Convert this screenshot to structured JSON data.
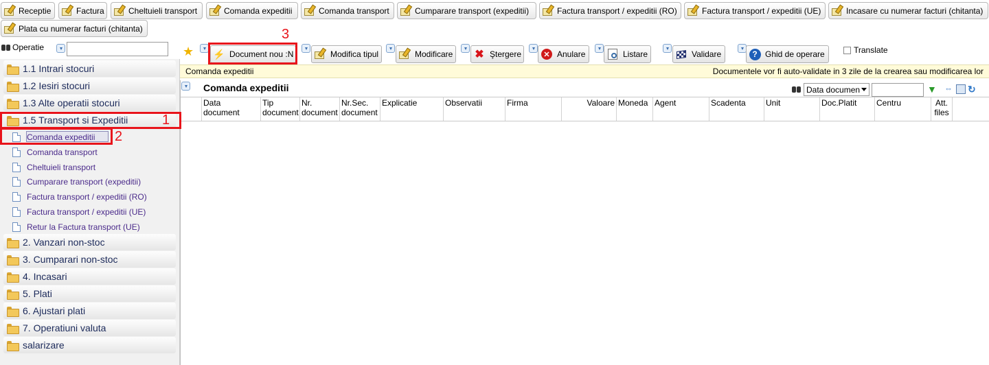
{
  "quick_tabs": [
    "Receptie",
    "Factura",
    "Cheltuieli transport",
    "Comanda expeditii",
    "Comanda transport",
    "Cumparare transport (expeditii)",
    "Factura transport / expeditii (RO)",
    "Factura transport / expeditii (UE)",
    "Incasare cu numerar facturi (chitanta)",
    "Plata cu numerar facturi (chitanta)"
  ],
  "operatie": {
    "label": "Operatie",
    "search_value": ""
  },
  "sidebar": {
    "groups": [
      "1.1 Intrari stocuri",
      "1.2 Iesiri stocuri",
      "1.3 Alte operatii stocuri",
      "1.5 Transport si Expeditii",
      "2. Vanzari non-stoc",
      "3. Cumparari non-stoc",
      "4. Incasari",
      "5. Plati",
      "6. Ajustari plati",
      "7. Operatiuni valuta",
      "salarizare"
    ],
    "sub_items": [
      "Comanda expeditii",
      "Comanda transport",
      "Cheltuieli transport",
      "Cumparare transport (expeditii)",
      "Factura transport / expeditii (RO)",
      "Factura transport / expeditii (UE)",
      "Retur la Factura transport (UE)"
    ]
  },
  "toolbar": {
    "document_nou": "Document nou :N",
    "modifica_tipul": "Modifica tipul",
    "modificare": "Modificare",
    "stergere": "Ştergere",
    "anulare": "Anulare",
    "listare": "Listare",
    "validare": "Validare",
    "ghid": "Ghid de operare",
    "translate": "Translate"
  },
  "infobar": {
    "left": "Comanda expeditii",
    "right": "Documentele vor fi auto-validate in 3 zile de la crearea sau modificarea lor"
  },
  "panel": {
    "title": "Comanda expeditii",
    "sort_select": "Data documen",
    "search_value": ""
  },
  "columns": [
    {
      "l1": "Data",
      "l2": "document"
    },
    {
      "l1": "Tip",
      "l2": "document"
    },
    {
      "l1": "Nr.",
      "l2": "document"
    },
    {
      "l1": "Nr.Sec.",
      "l2": "document"
    },
    {
      "l1": "Explicatie",
      "l2": ""
    },
    {
      "l1": "Observatii",
      "l2": ""
    },
    {
      "l1": "Firma",
      "l2": ""
    },
    {
      "l1": "Valoare",
      "l2": ""
    },
    {
      "l1": "Moneda",
      "l2": ""
    },
    {
      "l1": "Agent",
      "l2": ""
    },
    {
      "l1": "Scadenta",
      "l2": ""
    },
    {
      "l1": "Unit",
      "l2": ""
    },
    {
      "l1": "Doc.Platit",
      "l2": ""
    },
    {
      "l1": "Centru",
      "l2": ""
    },
    {
      "l1": "Att.",
      "l2": "files"
    }
  ],
  "annotations": [
    "1",
    "2",
    "3"
  ],
  "colors": {
    "highlight": "#e8141b",
    "info_bg": "#fffbd9",
    "sub_link": "#4a2a8a"
  }
}
